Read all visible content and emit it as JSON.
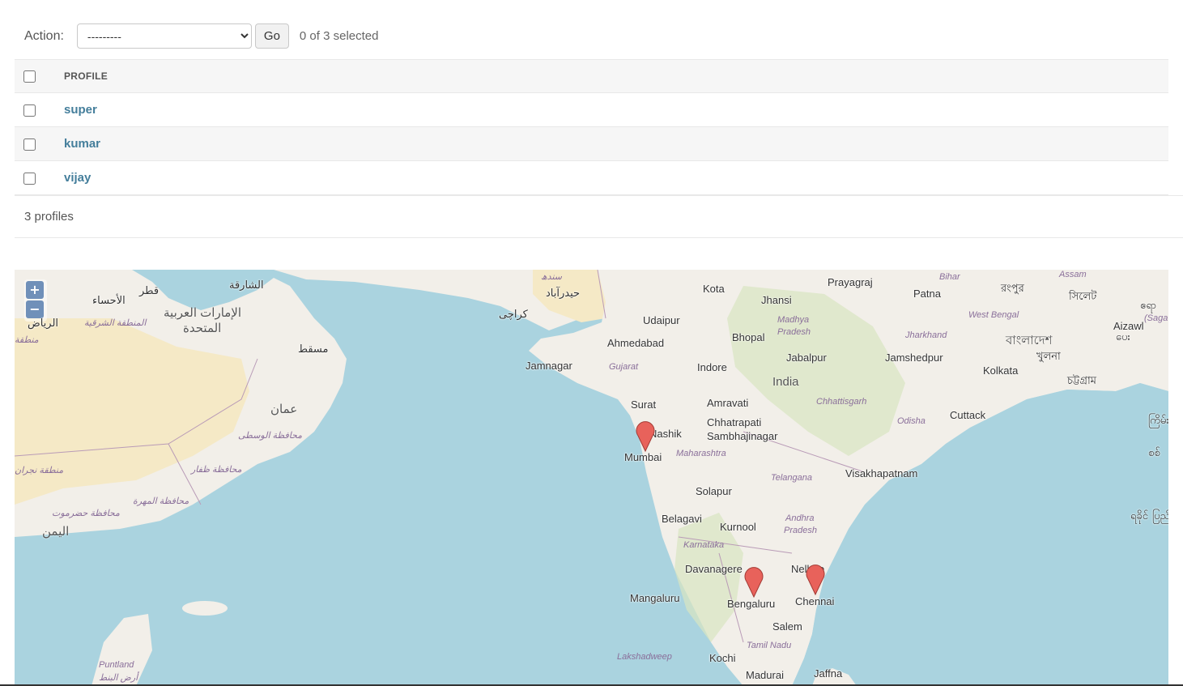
{
  "actions": {
    "label": "Action:",
    "select_value": "---------",
    "go_label": "Go",
    "selection_counter": "0 of 3 selected"
  },
  "table": {
    "column_header": "PROFILE",
    "rows": [
      {
        "name": "super"
      },
      {
        "name": "kumar"
      },
      {
        "name": "vijay"
      }
    ]
  },
  "paginator": {
    "text": "3 profiles"
  },
  "map": {
    "zoom_in": "+",
    "zoom_out": "−",
    "colors": {
      "water": "#aad3df",
      "land": "#f2efe9",
      "desert": "#f5e9c6",
      "marker": "#e8625b"
    },
    "markers": [
      {
        "city": "Mumbai"
      },
      {
        "city": "Bengaluru"
      },
      {
        "city": "Chennai"
      }
    ],
    "cities": {
      "kota": "Kota",
      "prayagraj": "Prayagraj",
      "patna": "Patna",
      "jhansi": "Jhansi",
      "udaipur": "Udaipur",
      "ahmedabad": "Ahmedabad",
      "bhopal": "Bhopal",
      "jabalpur": "Jabalpur",
      "jamshedpur": "Jamshedpur",
      "kolkata": "Kolkata",
      "jamnagar": "Jamnagar",
      "indore": "Indore",
      "surat": "Surat",
      "amravati": "Amravati",
      "cuttack": "Cuttack",
      "nashik": "Nashik",
      "chhatrapati": "Chhatrapati",
      "sambhajinagar": "Sambhajinagar",
      "mumbai": "Mumbai",
      "visakhapatnam": "Visakhapatnam",
      "solapur": "Solapur",
      "belagavi": "Belagavi",
      "kurnool": "Kurnool",
      "davanagere": "Davanagere",
      "nellore": "Nellore",
      "mangaluru": "Mangaluru",
      "bengaluru": "Bengaluru",
      "chennai": "Chennai",
      "salem": "Salem",
      "kochi": "Kochi",
      "madurai": "Madurai",
      "jaffna": "Jaffna",
      "aizawl": "Aizawl",
      "muscat": "مسقط",
      "karachi": "کراچی",
      "hyderabad_pk": "حیدرآباد",
      "sindh": "سندھ",
      "sharjah": "الشارقة",
      "qatar": "قطر",
      "ahsa": "الأحساء",
      "riyadh": "الرياض",
      "eastern_prov": "المنطقة الشرقية",
      "uae_1": "الإمارات العربية",
      "uae_2": "المتحدة",
      "oman": "عمان",
      "wusta": "محافظة الوسطى",
      "dhofar": "محافظة ظفار",
      "najran": "منطقة نجران",
      "mahrah": "محافظة المهرة",
      "hadramaut": "محافظة حضرموت",
      "yemen": "اليمن",
      "puntland": "Puntland",
      "puntland_ar": "أرض البنط",
      "mantiqa": "منطقة",
      "rangpur": "রংপুর",
      "sylhet": "সিলেট",
      "khulna": "খুলনা",
      "bangladesh": "বাংলাদেশ",
      "chittagong": "চট্টগ্রাম",
      "myanmar_1": "ဧရာ",
      "myanmar_2": "ပေး",
      "myanmar_3": "ကြိမ်း",
      "myanmar_4": "စစ်",
      "myanmar_5": "ရခိုင်",
      "myanmar_6": "ပြည်"
    },
    "countries": {
      "india": "India"
    },
    "regions": {
      "bihar": "Bihar",
      "assam": "Assam",
      "madhya_1": "Madhya",
      "madhya_2": "Pradesh",
      "west_bengal": "West Bengal",
      "jharkhand": "Jharkhand",
      "gujarat": "Gujarat",
      "chhattisgarh": "Chhattisgarh",
      "odisha": "Odisha",
      "maharashtra": "Maharashtra",
      "telangana": "Telangana",
      "andhra_1": "Andhra",
      "andhra_2": "Pradesh",
      "karnataka": "Karnataka",
      "tamil_nadu": "Tamil Nadu",
      "lakshadweep": "Lakshadweep",
      "saga": "(Saga"
    }
  }
}
